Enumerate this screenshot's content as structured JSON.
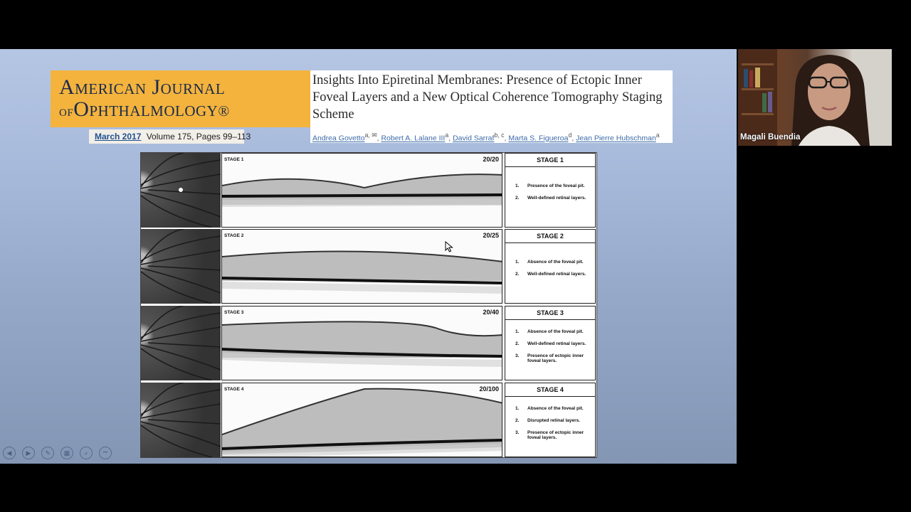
{
  "journal": {
    "name_line1": "American Journal",
    "name_line2_prefix": "of",
    "name_line2": "Ophthalmology",
    "registered": "®",
    "issue_date": "March 2017",
    "issue_details": "Volume 175, Pages 99–113"
  },
  "article": {
    "title": "Insights Into Epiretinal Membranes: Presence of Ectopic Inner Foveal Layers and a New Optical Coherence Tomography Staging Scheme",
    "authors": [
      {
        "name": "Andrea Govetto",
        "sup": "a, ✉"
      },
      {
        "name": "Robert A. Lalane III",
        "sup": "a"
      },
      {
        "name": "David Sarraf",
        "sup": "b, c"
      },
      {
        "name": "Marta S. Figueroa",
        "sup": "d"
      },
      {
        "name": "Jean Pierre Hubschman",
        "sup": "a"
      }
    ]
  },
  "stages": [
    {
      "label": "STAGE 1",
      "title": "STAGE 1",
      "va": "20/20",
      "criteria": [
        "Presence of the foveal pit.",
        "Well-defined retinal layers."
      ]
    },
    {
      "label": "STAGE 2",
      "title": "STAGE 2",
      "va": "20/25",
      "criteria": [
        "Absence of the foveal pit.",
        "Well-defined retinal layers."
      ]
    },
    {
      "label": "STAGE 3",
      "title": "STAGE 3",
      "va": "20/40",
      "criteria": [
        "Absence of the foveal pit.",
        "Well-defined retinal layers.",
        "Presence of ectopic inner foveal layers."
      ]
    },
    {
      "label": "STAGE 4",
      "title": "STAGE 4",
      "va": "20/100",
      "criteria": [
        "Absence of the foveal pit.",
        "Disrupted retinal layers.",
        "Presence of ectopic inner foveal layers."
      ]
    }
  ],
  "list_numbers": [
    "1.",
    "2.",
    "3."
  ],
  "controls": [
    {
      "name": "previous-slide-button",
      "icon": "arrow-left-icon",
      "glyph": "◀"
    },
    {
      "name": "next-slide-button",
      "icon": "arrow-right-icon",
      "glyph": "▶"
    },
    {
      "name": "pen-tool-button",
      "icon": "pen-icon",
      "glyph": "✎"
    },
    {
      "name": "slides-grid-button",
      "icon": "grid-icon",
      "glyph": "▦"
    },
    {
      "name": "zoom-button",
      "icon": "magnifier-icon",
      "glyph": "⌕"
    },
    {
      "name": "more-options-button",
      "icon": "more-icon",
      "glyph": "•••"
    }
  ],
  "participant": {
    "name": "Magali Buendia"
  }
}
